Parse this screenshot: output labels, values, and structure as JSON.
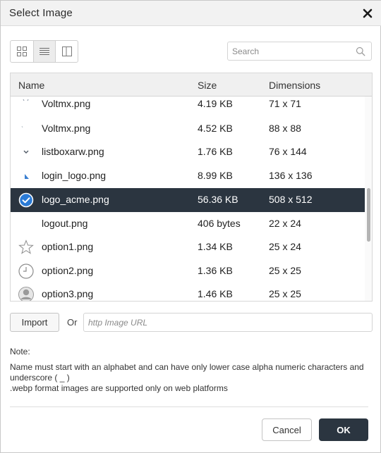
{
  "dialog": {
    "title": "Select Image",
    "close_icon": "close-icon"
  },
  "view_modes": [
    {
      "name": "grid-view",
      "icon": "grid-icon",
      "active": false
    },
    {
      "name": "list-view",
      "icon": "list-icon",
      "active": true
    },
    {
      "name": "split-view",
      "icon": "split-panel-icon",
      "active": false
    }
  ],
  "search": {
    "placeholder": "Search",
    "value": "",
    "icon": "search-icon"
  },
  "table": {
    "columns": [
      "Name",
      "Size",
      "Dimensions"
    ],
    "rows": [
      {
        "name": "Voltmx.png",
        "size": "4.19 KB",
        "dimensions": "71 x 71",
        "icon": "voltmx-thumb",
        "selected": false
      },
      {
        "name": "Voltmx.png",
        "size": "4.52 KB",
        "dimensions": "88 x 88",
        "icon": "voltmx-thumb",
        "selected": false
      },
      {
        "name": "listboxarw.png",
        "size": "1.76 KB",
        "dimensions": "76 x 144",
        "icon": "chevron-down-thumb",
        "selected": false
      },
      {
        "name": "login_logo.png",
        "size": "8.99 KB",
        "dimensions": "136 x 136",
        "icon": "login-logo-thumb",
        "selected": false
      },
      {
        "name": "logo_acme.png",
        "size": "56.36 KB",
        "dimensions": "508 x 512",
        "icon": "check-circle-icon",
        "selected": true
      },
      {
        "name": "logout.png",
        "size": "406 bytes",
        "dimensions": "22 x 24",
        "icon": "blank-thumb",
        "selected": false
      },
      {
        "name": "option1.png",
        "size": "1.34 KB",
        "dimensions": "25 x 24",
        "icon": "star-outline-thumb",
        "selected": false
      },
      {
        "name": "option2.png",
        "size": "1.36 KB",
        "dimensions": "25 x 25",
        "icon": "clock-thumb",
        "selected": false
      },
      {
        "name": "option3.png",
        "size": "1.46 KB",
        "dimensions": "25 x 25",
        "icon": "user-avatar-thumb",
        "selected": false
      }
    ]
  },
  "import": {
    "button_label": "Import",
    "or_label": "Or",
    "url_placeholder": "http Image URL",
    "url_value": ""
  },
  "note": {
    "heading": "Note:",
    "line1": "Name must start with an alphabet and can have only lower case alpha numeric characters and underscore ( _ )",
    "line2": ".webp format images are supported only on web platforms"
  },
  "footer": {
    "cancel_label": "Cancel",
    "ok_label": "OK"
  },
  "colors": {
    "selected_row_bg": "#2b3540",
    "primary_button_bg": "#2b3540",
    "accent_blue": "#2b7bd6"
  }
}
